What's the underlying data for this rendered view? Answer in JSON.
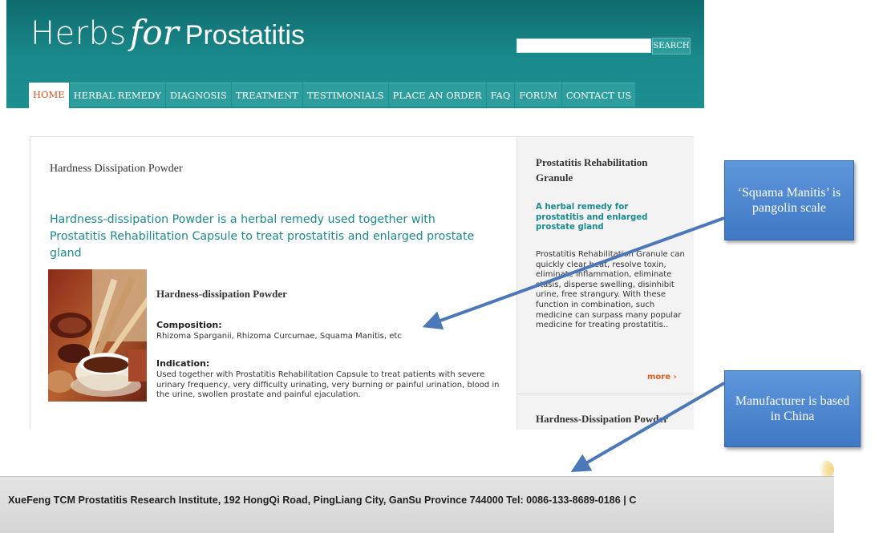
{
  "header": {
    "logo": {
      "part1": "Herbs",
      "part2": "for",
      "part3": "Prostatitis"
    },
    "search": {
      "placeholder": "",
      "button_label": "SEARCH"
    },
    "nav": [
      {
        "label": "HOME",
        "active": true
      },
      {
        "label": "HERBAL REMEDY"
      },
      {
        "label": "DIAGNOSIS"
      },
      {
        "label": "TREATMENT"
      },
      {
        "label": "TESTIMONIALS"
      },
      {
        "label": "PLACE AN ORDER"
      },
      {
        "label": "FAQ"
      },
      {
        "label": "FORUM"
      },
      {
        "label": "CONTACT US"
      }
    ]
  },
  "main": {
    "page_title": "Hardness Dissipation Powder",
    "lead": "Hardness-dissipation Powder is a herbal remedy used together with Prostatitis Rehabilitation Capsule to treat prostatitis and enlarged prostate gland",
    "product_name": "Hardness-dissipation Powder",
    "composition_label": "Composition:",
    "composition_text": "Rhizoma Sparganii, Rhizoma Curcumae, Squama Manitis, etc",
    "indication_label": "Indication:",
    "indication_text": "Used together with Prostatitis Rehabilitation Capsule to treat patients with severe urinary frequency, very difficulty urinating, very burning or painful urination, blood in the urine, swollen prostate and painful ejaculation."
  },
  "sidebar": {
    "title": "Prostatitis Rehabilitation Granule",
    "subtitle": "A herbal remedy for prostatitis and enlarged prostate gland",
    "text": "Prostatitis Rehabilitation Granule can quickly clear heat, resolve toxin, eliminate inflammation, eliminate stasis, disperse swelling, disinhibit urine, free strangury. With these function in combination, such medicine can surpass many popular medicine for treating prostatitis..",
    "more_label": "more ›",
    "title_2": "Hardness-Dissipation Powder"
  },
  "footer": {
    "text": "XueFeng TCM Prostatitis Research Institute, 192 HongQi Road, PingLiang City, GanSu Province 744000 Tel: 0086-133-8689-0186 | C"
  },
  "callouts": {
    "squama": "‘Squama Manitis’ is pangolin scale",
    "china": "Manufacturer is based in China"
  },
  "colors": {
    "header_teal": "#1a8a8c",
    "nav_active_text": "#d9531e",
    "link_teal": "#1a8a8f",
    "more_orange": "#e25b1e",
    "callout_blue": "#4f86cf"
  }
}
